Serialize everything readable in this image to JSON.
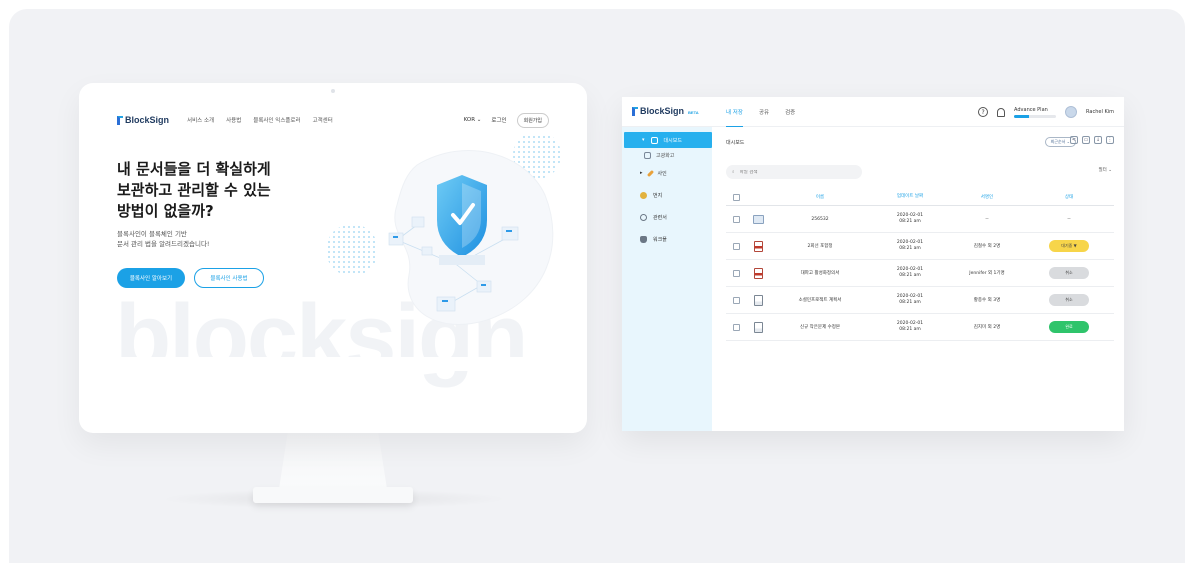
{
  "landing": {
    "logo": "BlockSign",
    "nav": [
      "서비스 소개",
      "사용법",
      "블록사인 익스플로러",
      "고객센터"
    ],
    "language": "KOR",
    "login": "로그인",
    "signup": "회원가입",
    "hero_title": "내 문서들을 더 확실하게\n보관하고 관리할 수 있는\n방법이 없을까?",
    "hero_sub": "블록사인이 블록체인 기반\n문서 관리 법을 알려드리겠습니다!",
    "cta_primary": "블록사인 알아보기",
    "cta_secondary": "블록사인 사용법",
    "watermark": "blocksign"
  },
  "app": {
    "logo": "BlockSign",
    "beta": "BETA",
    "tabs": [
      "내 저장",
      "공유",
      "검증"
    ],
    "plan_label": "Advance Plan",
    "plan_progress": 0.35,
    "user_name": "Rachel Kim",
    "sidebar": {
      "items": [
        {
          "label": "대시보드",
          "icon": "folder-icon",
          "active": true
        },
        {
          "label": "사인",
          "icon": "pen-icon"
        },
        {
          "label": "번지",
          "icon": "badge-icon"
        },
        {
          "label": "관련서",
          "icon": "gear-icon"
        },
        {
          "label": "워크플",
          "icon": "database-icon"
        }
      ],
      "sub_items": [
        {
          "label": "고광화고",
          "icon": "folder-icon"
        }
      ]
    },
    "content": {
      "folder_title": "대시보드",
      "sort_label": "최근순서",
      "search_placeholder": "파일 검색",
      "filter_label": "필터",
      "columns": [
        "이름",
        "업데이트 날짜",
        "서명인",
        "상태"
      ],
      "rows": [
        {
          "icon": "folder-icon",
          "name": "256532",
          "date": "2020-02-01\n08:21 am",
          "signer": "--",
          "status": "--",
          "status_kind": "none"
        },
        {
          "icon": "pdf-icon",
          "name": "2회선 포함정",
          "date": "2020-02-01\n08:21 am",
          "signer": "김철수 외 2명",
          "status": "대기중 ▼",
          "status_kind": "pending"
        },
        {
          "icon": "pdf-icon",
          "name": "대파고 활성화정의서",
          "date": "2020-02-01\n08:21 am",
          "signer": "Jennifer 외 1기명",
          "status": "취소",
          "status_kind": "canceled"
        },
        {
          "icon": "doc-icon",
          "name": "소셜민프로젝트 계획서",
          "date": "2020-02-01\n08:21 am",
          "signer": "황종수 외 3명",
          "status": "취소",
          "status_kind": "canceled"
        },
        {
          "icon": "doc-icon",
          "name": "신규 작은문제 수정본",
          "date": "2020-02-01\n08:21 am",
          "signer": "김지미 외 2명",
          "status": "완료",
          "status_kind": "done"
        }
      ]
    }
  },
  "colors": {
    "accent": "#1ba1e6",
    "pending": "#f7d54a",
    "canceled": "#d9dbde",
    "done": "#2fc46b"
  }
}
